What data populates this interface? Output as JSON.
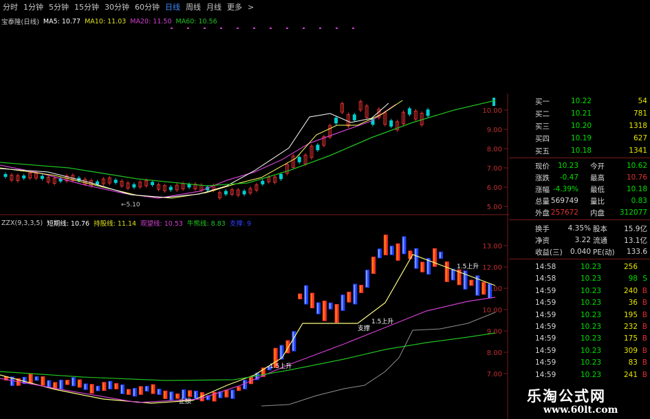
{
  "toolbar": {
    "periods": [
      "分时",
      "1分钟",
      "5分钟",
      "15分钟",
      "30分钟",
      "60分钟",
      "日线",
      "周线",
      "月线",
      "更多"
    ],
    "active": "日线",
    "more_arrow": ">"
  },
  "main_legend": {
    "title": "宝泰隆(日线)",
    "ma5": "MA5: 10.77",
    "ma10": "MA10: 11.03",
    "ma20": "MA20: 11.50",
    "ma60": "MA60: 10.56"
  },
  "price_axis": [
    "10.00",
    "9.00",
    "8.00",
    "7.00",
    "6.00",
    "5.00"
  ],
  "low_label": "←5.10",
  "sub_legend": {
    "title": "ZZX(9,3,3,5)",
    "l1": "短期线: 10.76",
    "l2": "持股线: 11.14",
    "l3": "观望线: 10.53",
    "l4": "牛熊线: 8.83",
    "l5": "支撑: 9"
  },
  "sub_axis": [
    "13.00",
    "12.00",
    "11.00",
    "10.00",
    "9.00",
    "8.00",
    "7.00"
  ],
  "sub_annotations": [
    "1.5上升",
    "1.5上升",
    "1.5上升",
    "支撑",
    "止损"
  ],
  "orderbook": [
    {
      "label": "买一",
      "price": "10.22",
      "vol": "54"
    },
    {
      "label": "买二",
      "price": "10.21",
      "vol": "781"
    },
    {
      "label": "买三",
      "price": "10.20",
      "vol": "1318"
    },
    {
      "label": "买四",
      "price": "10.19",
      "vol": "627"
    },
    {
      "label": "买五",
      "price": "10.18",
      "vol": "1341"
    }
  ],
  "quote": [
    {
      "l1": "现价",
      "v1": "10.23",
      "c1": "#00e000",
      "l2": "今开",
      "v2": "10.62",
      "c2": "#00e000"
    },
    {
      "l1": "涨跌",
      "v1": "-0.47",
      "c1": "#00e000",
      "l2": "最高",
      "v2": "10.76",
      "c2": "#e03030"
    },
    {
      "l1": "涨幅",
      "v1": "-4.39%",
      "c1": "#00e000",
      "l2": "最低",
      "v2": "10.18",
      "c2": "#00e000"
    },
    {
      "l1": "总量",
      "v1": "569749",
      "c1": "#d8d8d8",
      "l2": "量比",
      "v2": "0.83",
      "c2": "#00e000"
    },
    {
      "l1": "外盘",
      "v1": "257672",
      "c1": "#e03030",
      "l2": "内盘",
      "v2": "312077",
      "c2": "#00e000"
    }
  ],
  "finance": [
    {
      "l1": "换手",
      "v1": "4.35%",
      "l2": "股本",
      "v2": "15.9亿"
    },
    {
      "l1": "净资",
      "v1": "3.22",
      "l2": "流通",
      "v2": "13.1亿"
    },
    {
      "l1": "收益(三)",
      "v1": "0.040",
      "l2": "PE(动)",
      "v2": "133.6"
    }
  ],
  "ticks": [
    {
      "time": "14:58",
      "price": "10.23",
      "vol": "256",
      "side": ""
    },
    {
      "time": "14:58",
      "price": "10.23",
      "vol": "98",
      "side": "S"
    },
    {
      "time": "14:59",
      "price": "10.23",
      "vol": "240",
      "side": "B"
    },
    {
      "time": "14:59",
      "price": "10.23",
      "vol": "36",
      "side": "B"
    },
    {
      "time": "14:59",
      "price": "10.23",
      "vol": "195",
      "side": "B"
    },
    {
      "time": "14:59",
      "price": "10.23",
      "vol": "232",
      "side": "B"
    },
    {
      "time": "14:59",
      "price": "10.23",
      "vol": "175",
      "side": "B"
    },
    {
      "time": "14:59",
      "price": "10.23",
      "vol": "309",
      "side": "B"
    },
    {
      "time": "14:59",
      "price": "10.23",
      "vol": "83",
      "side": "B"
    },
    {
      "time": "14:59",
      "price": "10.23",
      "vol": "241",
      "side": "B"
    }
  ],
  "watermark": {
    "name": "乐淘公式网",
    "url": "www.60lt.com"
  },
  "colors": {
    "up": "#e03030",
    "down": "#00d0d0",
    "ma5": "#ffffff",
    "ma10": "#ffff60",
    "ma20": "#d040d0",
    "ma60": "#20c020",
    "zzx_up": "#ff3030",
    "zzx_down": "#2040ff",
    "panel_sep": "#7a1a1a",
    "orange": "#ff8000"
  }
}
